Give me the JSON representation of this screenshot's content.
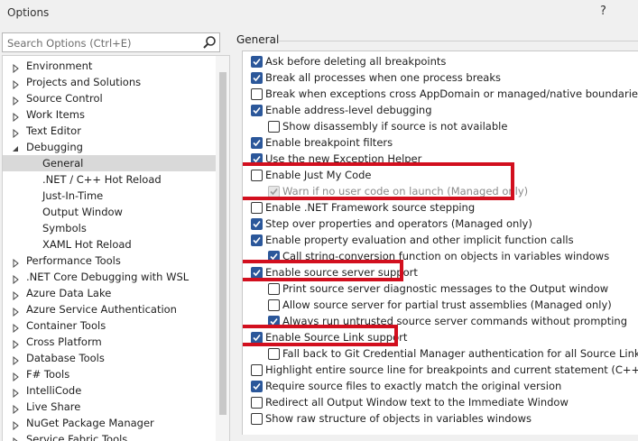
{
  "window": {
    "title": "Options",
    "help_label": "?"
  },
  "search": {
    "placeholder": "Search Options (Ctrl+E)"
  },
  "tree": [
    {
      "label": "Environment",
      "indent": 0,
      "expander": "collapsed",
      "selected": false
    },
    {
      "label": "Projects and Solutions",
      "indent": 0,
      "expander": "collapsed",
      "selected": false
    },
    {
      "label": "Source Control",
      "indent": 0,
      "expander": "collapsed",
      "selected": false
    },
    {
      "label": "Work Items",
      "indent": 0,
      "expander": "collapsed",
      "selected": false
    },
    {
      "label": "Text Editor",
      "indent": 0,
      "expander": "collapsed",
      "selected": false
    },
    {
      "label": "Debugging",
      "indent": 0,
      "expander": "expanded",
      "selected": false
    },
    {
      "label": "General",
      "indent": 1,
      "expander": "none",
      "selected": true
    },
    {
      "label": ".NET / C++ Hot Reload",
      "indent": 1,
      "expander": "none",
      "selected": false
    },
    {
      "label": "Just-In-Time",
      "indent": 1,
      "expander": "none",
      "selected": false
    },
    {
      "label": "Output Window",
      "indent": 1,
      "expander": "none",
      "selected": false
    },
    {
      "label": "Symbols",
      "indent": 1,
      "expander": "none",
      "selected": false
    },
    {
      "label": "XAML Hot Reload",
      "indent": 1,
      "expander": "none",
      "selected": false
    },
    {
      "label": "Performance Tools",
      "indent": 0,
      "expander": "collapsed",
      "selected": false
    },
    {
      "label": ".NET Core Debugging with WSL",
      "indent": 0,
      "expander": "collapsed",
      "selected": false
    },
    {
      "label": "Azure Data Lake",
      "indent": 0,
      "expander": "collapsed",
      "selected": false
    },
    {
      "label": "Azure Service Authentication",
      "indent": 0,
      "expander": "collapsed",
      "selected": false
    },
    {
      "label": "Container Tools",
      "indent": 0,
      "expander": "collapsed",
      "selected": false
    },
    {
      "label": "Cross Platform",
      "indent": 0,
      "expander": "collapsed",
      "selected": false
    },
    {
      "label": "Database Tools",
      "indent": 0,
      "expander": "collapsed",
      "selected": false
    },
    {
      "label": "F# Tools",
      "indent": 0,
      "expander": "collapsed",
      "selected": false
    },
    {
      "label": "IntelliCode",
      "indent": 0,
      "expander": "collapsed",
      "selected": false
    },
    {
      "label": "Live Share",
      "indent": 0,
      "expander": "collapsed",
      "selected": false
    },
    {
      "label": "NuGet Package Manager",
      "indent": 0,
      "expander": "collapsed",
      "selected": false
    },
    {
      "label": "Service Fabric Tools",
      "indent": 0,
      "expander": "collapsed",
      "selected": false
    }
  ],
  "panel": {
    "group_label": "General"
  },
  "options": [
    {
      "label": "Ask before deleting all breakpoints",
      "indent": 0,
      "state": "checked"
    },
    {
      "label": "Break all processes when one process breaks",
      "indent": 0,
      "state": "checked"
    },
    {
      "label": "Break when exceptions cross AppDomain or managed/native boundaries (Ma",
      "indent": 0,
      "state": "unchecked"
    },
    {
      "label": "Enable address-level debugging",
      "indent": 0,
      "state": "checked"
    },
    {
      "label": "Show disassembly if source is not available",
      "indent": 1,
      "state": "unchecked"
    },
    {
      "label": "Enable breakpoint filters",
      "indent": 0,
      "state": "checked"
    },
    {
      "label": "Use the new Exception Helper",
      "indent": 0,
      "state": "checked"
    },
    {
      "label": "Enable Just My Code",
      "indent": 0,
      "state": "unchecked"
    },
    {
      "label": "Warn if no user code on launch (Managed only)",
      "indent": 1,
      "state": "checked-disabled"
    },
    {
      "label": "Enable .NET Framework source stepping",
      "indent": 0,
      "state": "unchecked"
    },
    {
      "label": "Step over properties and operators (Managed only)",
      "indent": 0,
      "state": "checked"
    },
    {
      "label": "Enable property evaluation and other implicit function calls",
      "indent": 0,
      "state": "checked"
    },
    {
      "label": "Call string-conversion function on objects in variables windows",
      "indent": 1,
      "state": "checked"
    },
    {
      "label": "Enable source server support",
      "indent": 0,
      "state": "checked"
    },
    {
      "label": "Print source server diagnostic messages to the Output window",
      "indent": 1,
      "state": "unchecked"
    },
    {
      "label": "Allow source server for partial trust assemblies (Managed only)",
      "indent": 1,
      "state": "unchecked"
    },
    {
      "label": "Always run untrusted source server commands without prompting",
      "indent": 1,
      "state": "checked"
    },
    {
      "label": "Enable Source Link support",
      "indent": 0,
      "state": "checked"
    },
    {
      "label": "Fall back to Git Credential Manager authentication for all Source Link requ",
      "indent": 1,
      "state": "unchecked"
    },
    {
      "label": "Highlight entire source line for breakpoints and current statement (C++ only",
      "indent": 0,
      "state": "unchecked"
    },
    {
      "label": "Require source files to exactly match the original version",
      "indent": 0,
      "state": "checked"
    },
    {
      "label": "Redirect all Output Window text to the Immediate Window",
      "indent": 0,
      "state": "unchecked"
    },
    {
      "label": "Show raw structure of objects in variables windows",
      "indent": 0,
      "state": "unchecked"
    }
  ],
  "highlights": [
    "Enable Just My Code",
    "Enable source server support",
    "Enable Source Link support"
  ],
  "colors": {
    "check_fill": "#2b579a",
    "highlight": "#d20f1e",
    "selection": "#d9d9d9"
  },
  "icons": {
    "search": "magnifier-icon",
    "expander_collapsed": "triangle-right-icon",
    "expander_expanded": "triangle-down-icon",
    "check": "checkmark-icon"
  }
}
